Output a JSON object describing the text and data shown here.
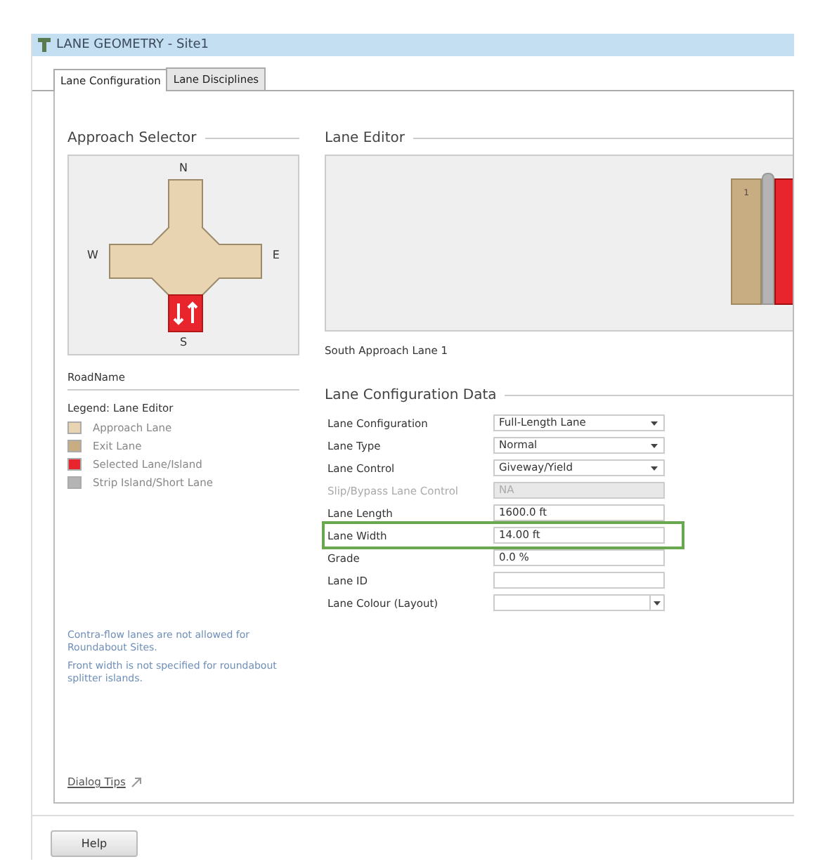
{
  "window": {
    "title": "LANE GEOMETRY - Site1"
  },
  "tabs": [
    {
      "label": "Lane Configuration",
      "selected": true
    },
    {
      "label": "Lane Disciplines",
      "selected": false
    }
  ],
  "approach_selector": {
    "title": "Approach Selector",
    "compass": {
      "north": "N",
      "west": "W",
      "east": "E",
      "south": "S"
    },
    "road_name": "RoadName"
  },
  "legend": {
    "title": "Legend: Lane Editor",
    "items": [
      {
        "label": "Approach Lane",
        "color": "#e8d4b0"
      },
      {
        "label": "Exit Lane",
        "color": "#c8ad82"
      },
      {
        "label": "Selected Lane/Island",
        "color": "#e8242c"
      },
      {
        "label": "Strip Island/Short Lane",
        "color": "#b4b4b4"
      }
    ]
  },
  "notes": [
    "Contra-flow lanes are not allowed for Roundabout Sites.",
    "Front width is not specified for roundabout splitter islands."
  ],
  "dialog_tips": "Dialog Tips",
  "lane_editor": {
    "title": "Lane Editor",
    "lanes": [
      {
        "kind": "lane",
        "label": "1",
        "selected": false
      },
      {
        "kind": "island"
      },
      {
        "kind": "lane",
        "selected": true
      }
    ],
    "caption": "South Approach Lane 1"
  },
  "config_data": {
    "title": "Lane Configuration Data",
    "rows": [
      {
        "label": "Lane Configuration",
        "kind": "dropdown",
        "value": "Full-Length Lane",
        "disabled": false,
        "highlighted": false
      },
      {
        "label": "Lane Type",
        "kind": "dropdown",
        "value": "Normal",
        "disabled": false,
        "highlighted": false
      },
      {
        "label": "Lane Control",
        "kind": "dropdown",
        "value": "Giveway/Yield",
        "disabled": false,
        "highlighted": false
      },
      {
        "label": "Slip/Bypass Lane Control",
        "kind": "text",
        "value": "NA",
        "disabled": true,
        "highlighted": false
      },
      {
        "label": "Lane Length",
        "kind": "text",
        "value": "1600.0 ft",
        "disabled": false,
        "highlighted": false
      },
      {
        "label": "Lane Width",
        "kind": "text",
        "value": "14.00 ft",
        "disabled": false,
        "highlighted": true
      },
      {
        "label": "Grade",
        "kind": "text",
        "value": "0.0 %",
        "disabled": false,
        "highlighted": false
      },
      {
        "label": "Lane ID",
        "kind": "text",
        "value": "",
        "disabled": false,
        "highlighted": false
      },
      {
        "label": "Lane Colour (Layout)",
        "kind": "color-dropdown",
        "value": "",
        "disabled": false,
        "highlighted": false
      }
    ]
  },
  "buttons": [
    {
      "label": "Help"
    }
  ]
}
